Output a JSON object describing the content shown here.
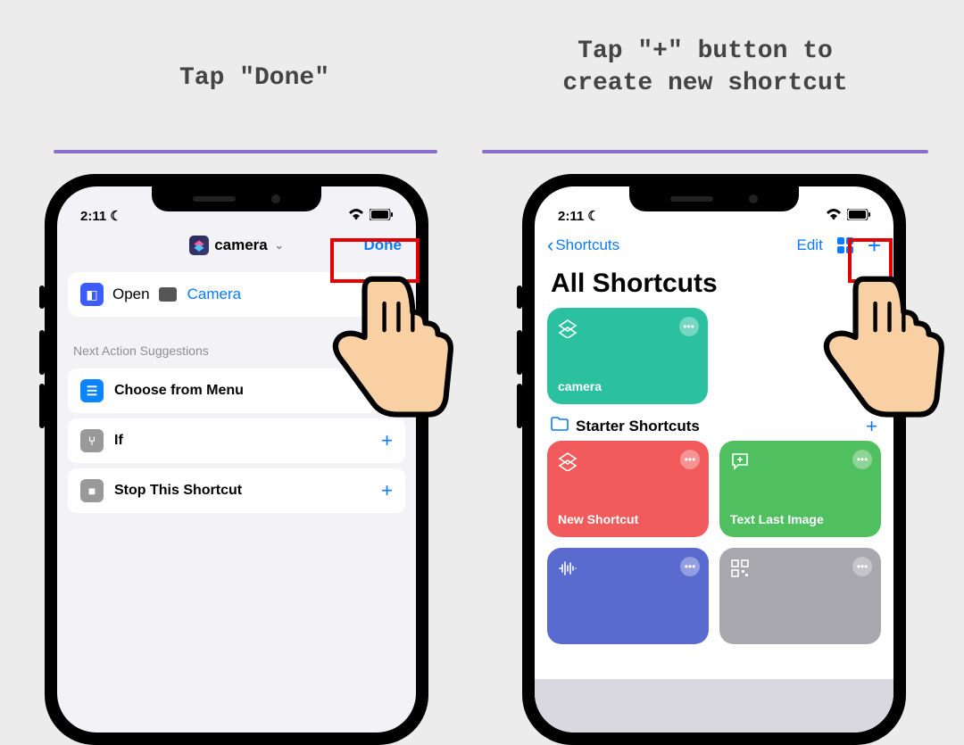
{
  "captions": {
    "left": "Tap \"Done\"",
    "right_l1": "Tap \"+\" button to",
    "right_l2": "create new shortcut"
  },
  "status": {
    "time": "2:11"
  },
  "left_phone": {
    "title": "camera",
    "done": "Done",
    "open_label": "Open",
    "open_target": "Camera",
    "section": "Next Action Suggestions",
    "sug1": "Choose from Menu",
    "sug2": "If",
    "sug3": "Stop This Shortcut"
  },
  "right_phone": {
    "back": "Shortcuts",
    "edit": "Edit",
    "title": "All Shortcuts",
    "tile_camera": "camera",
    "folder": "Starter Shortcuts",
    "tile_new": "New Shortcut",
    "tile_text": "Text Last Image"
  }
}
